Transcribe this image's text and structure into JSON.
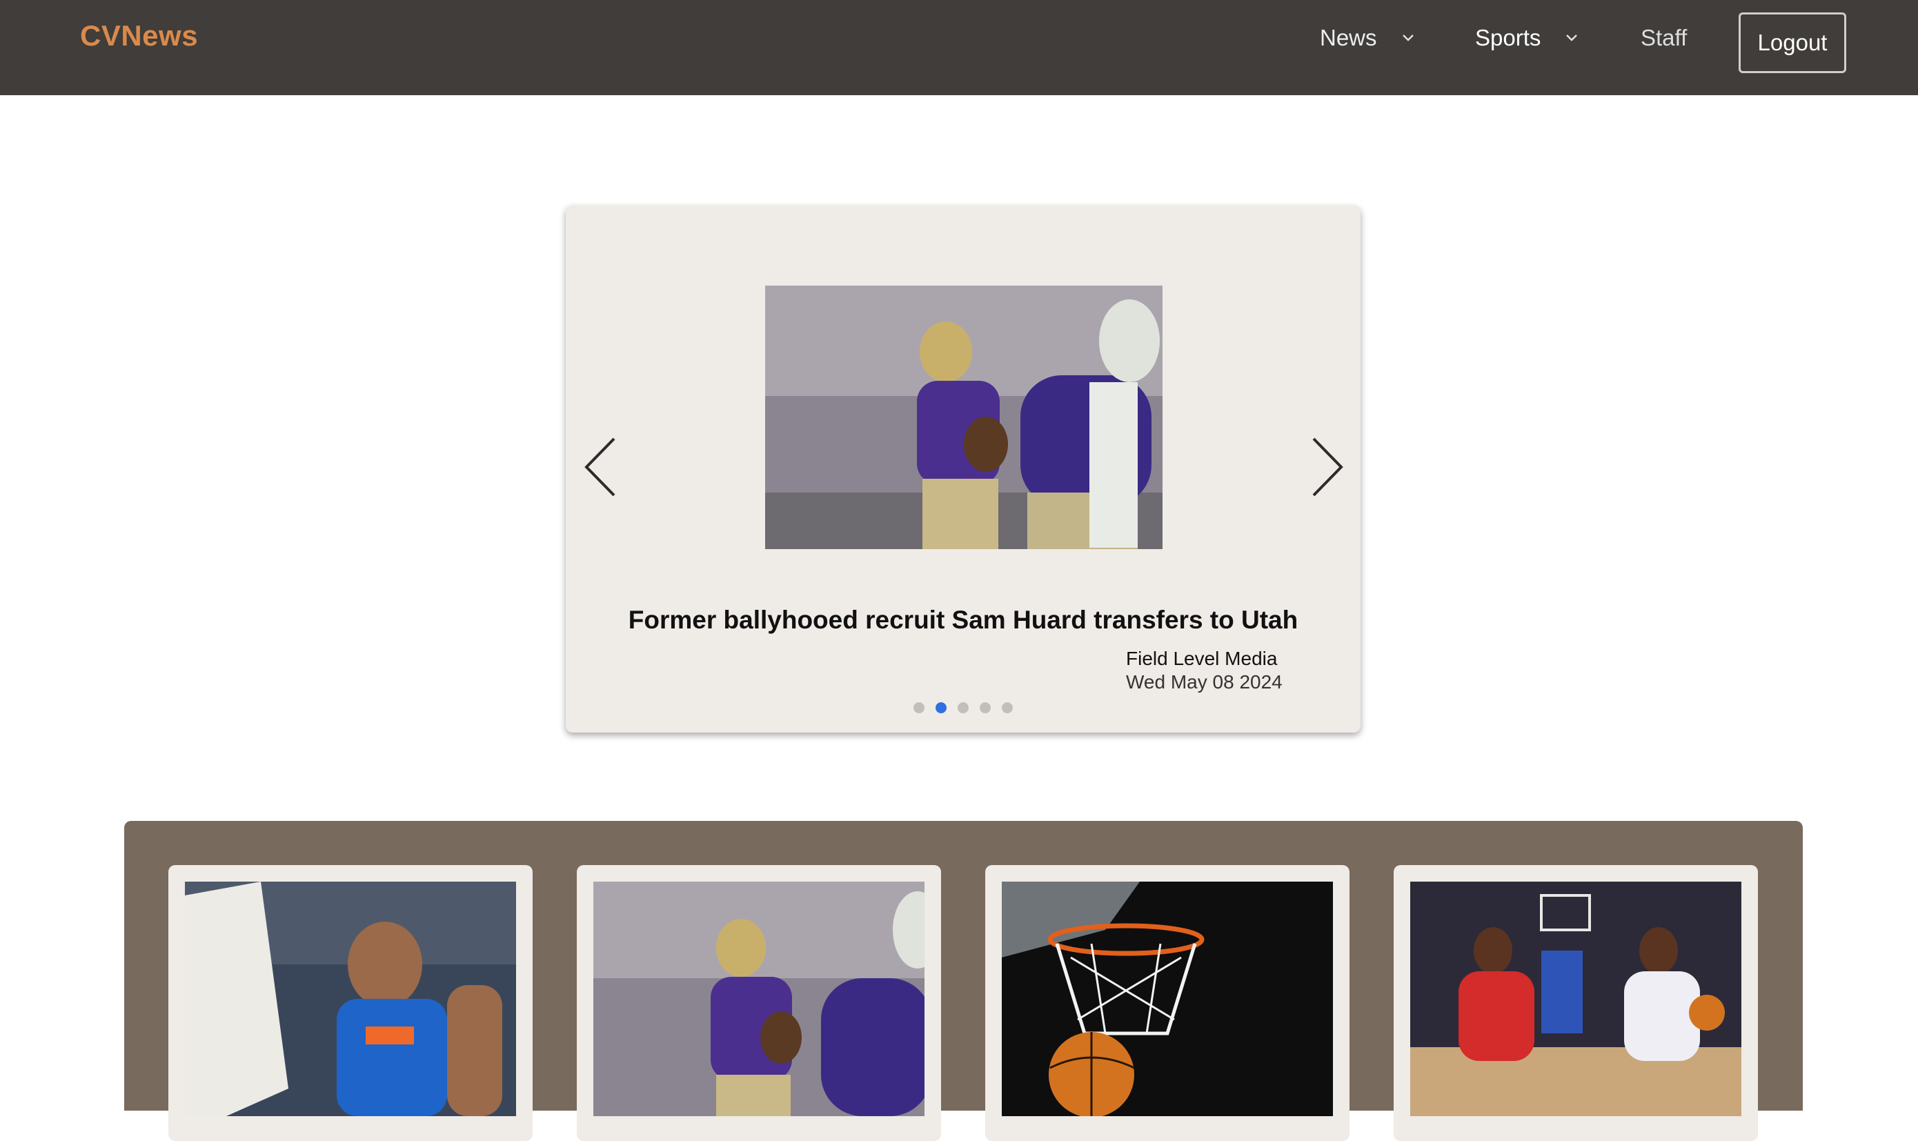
{
  "brand": "CVNews",
  "nav": {
    "news_label": "News",
    "sports_label": "Sports",
    "staff_label": "Staff",
    "logout_label": "Logout"
  },
  "carousel": {
    "title": "Former ballyhooed recruit Sam Huard transfers to Utah",
    "source": "Field Level Media",
    "date": "Wed May 08 2024",
    "slide_count": 5,
    "active_slide_index": 1
  },
  "cards": [
    {
      "image": "basketball-player-florida-photo"
    },
    {
      "image": "football-quarterback-photo"
    },
    {
      "image": "basketball-hoop-dunk-photo"
    },
    {
      "image": "basketball-players-dribbling-photo"
    }
  ],
  "colors": {
    "navbar_bg": "#403d3a",
    "brand": "#d98a4c",
    "card_bg": "#efebe6",
    "panel_bg": "#786a5d",
    "active_dot": "#2f6fe0"
  }
}
